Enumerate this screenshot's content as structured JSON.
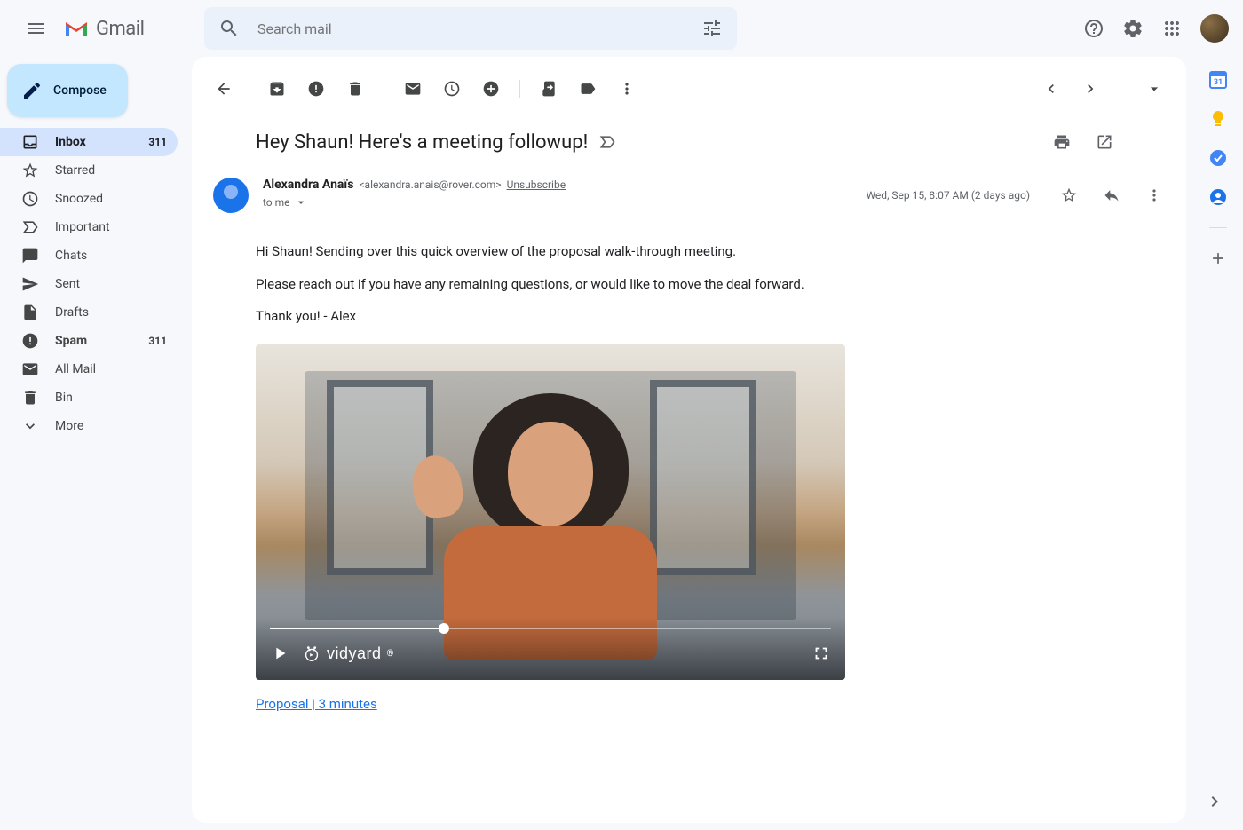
{
  "header": {
    "app_name": "Gmail",
    "search_placeholder": "Search mail"
  },
  "compose_label": "Compose",
  "nav": [
    {
      "icon": "inbox",
      "label": "Inbox",
      "count": "311",
      "active": true,
      "bold": true
    },
    {
      "icon": "star",
      "label": "Starred",
      "count": ""
    },
    {
      "icon": "clock",
      "label": "Snoozed",
      "count": ""
    },
    {
      "icon": "important",
      "label": "Important",
      "count": ""
    },
    {
      "icon": "chat",
      "label": "Chats",
      "count": ""
    },
    {
      "icon": "sent",
      "label": "Sent",
      "count": ""
    },
    {
      "icon": "draft",
      "label": "Drafts",
      "count": ""
    },
    {
      "icon": "spam",
      "label": "Spam",
      "count": "311",
      "bold": true
    },
    {
      "icon": "mail",
      "label": "All Mail",
      "count": ""
    },
    {
      "icon": "trash",
      "label": "Bin",
      "count": ""
    },
    {
      "icon": "more",
      "label": "More",
      "count": ""
    }
  ],
  "email": {
    "subject": "Hey Shaun! Here's a meeting followup!",
    "sender_name": "Alexandra Anaïs",
    "sender_email": "<alexandra.anais@rover.com>",
    "unsubscribe": "Unsubscribe",
    "to_line": "to me",
    "date": "Wed, Sep 15, 8:07 AM (2 days ago)",
    "body_p1": "Hi Shaun! Sending over this quick overview of the proposal walk-through meeting.",
    "body_p2": "Please reach out if you have any remaining questions, or would like to move the deal forward.",
    "body_p3": "Thank you! - Alex",
    "video_brand": "vidyard",
    "video_link_text": "Proposal | 3 minutes",
    "progress_percent": 31
  }
}
